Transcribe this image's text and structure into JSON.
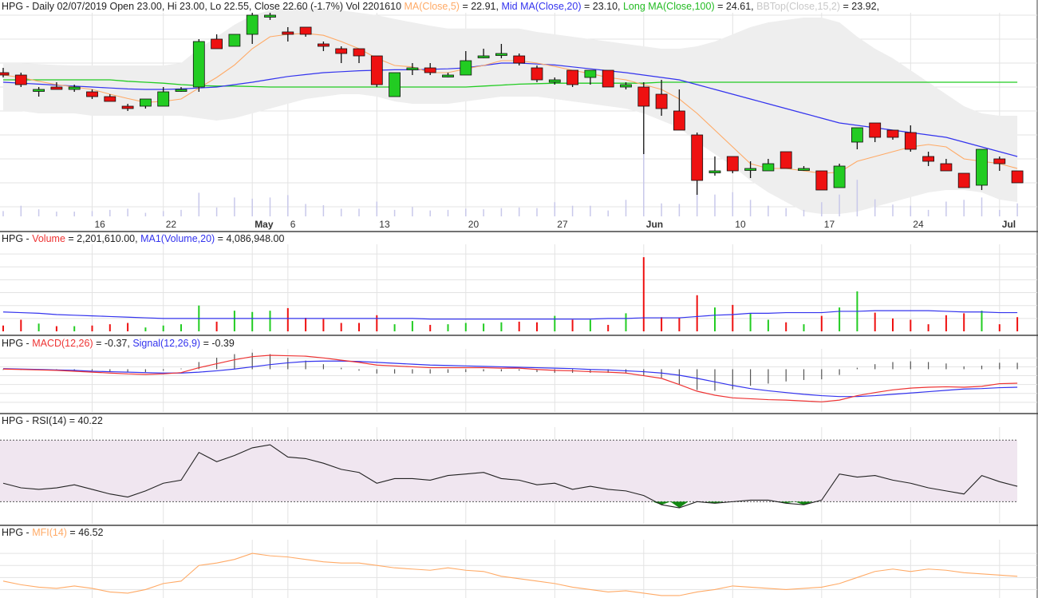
{
  "colors": {
    "up": "#22cc22",
    "down": "#ee1111",
    "ma5": "#ffaa66",
    "mid_ma": "#3333ee",
    "long_ma": "#22cc22",
    "bbtop": "#bbbbbb",
    "band": "#eeeeee",
    "volume": "#ee3333",
    "vol_ma": "#3333ee",
    "macd": "#ee3333",
    "signal": "#3333ee",
    "rsi": "#222222",
    "rsi_fill": "#f0e6f0",
    "rsi_low": "#118811",
    "mfi": "#ffaa66",
    "grid": "#e3e3e3",
    "border": "#444444"
  },
  "header": {
    "symbol": "HPG",
    "text": "HPG - Daily 02/07/2019 Open 23.00, Hi 23.00, Lo 22.55, Close 22.60 (-1.7%) Vol 2201610",
    "ma5_label": "MA(Close,5)",
    "ma5_value": " = 22.91, ",
    "mid_label": "Mid MA(Close,20)",
    "mid_value": " = 23.10, ",
    "long_label": "Long MA(Close,100)",
    "long_value": " = 24.61, ",
    "bb_label": "BBTop(Close,15,2)",
    "bb_value": " = 23.92, "
  },
  "volume_header": {
    "prefix": "HPG - ",
    "label": "Volume",
    "value": " = 2,201,610.00, ",
    "ma_label": "MA1(Volume,20)",
    "ma_value": " = 4,086,948.00"
  },
  "macd_header": {
    "prefix": "HPG - ",
    "label": "MACD(12,26)",
    "value": " = -0.37, ",
    "sig_label": "Signal(12,26,9)",
    "sig_value": " = -0.39"
  },
  "rsi_header": {
    "text": "HPG - RSI(14) = 40.22"
  },
  "mfi_header": {
    "prefix": "HPG - ",
    "label": "MFI(14)",
    "value": " = 46.52"
  },
  "chart_data": {
    "type": "candlestick",
    "price_range": [
      20.8,
      25.05
    ],
    "x_ticks": [
      {
        "i": 5,
        "label": "16"
      },
      {
        "i": 9,
        "label": "22"
      },
      {
        "i": 14,
        "label": "May",
        "bold": true
      },
      {
        "i": 16,
        "label": "6"
      },
      {
        "i": 21,
        "label": "13"
      },
      {
        "i": 26,
        "label": "20"
      },
      {
        "i": 31,
        "label": "27"
      },
      {
        "i": 36,
        "label": "Jun",
        "bold": true
      },
      {
        "i": 41,
        "label": "10"
      },
      {
        "i": 46,
        "label": "17"
      },
      {
        "i": 51,
        "label": "24"
      },
      {
        "i": 56,
        "label": "Jul",
        "bold": true
      }
    ],
    "candles": [
      {
        "o": 23.8,
        "h": 23.9,
        "l": 23.7,
        "c": 23.75
      },
      {
        "o": 23.75,
        "h": 23.8,
        "l": 23.5,
        "c": 23.55
      },
      {
        "o": 23.45,
        "h": 23.5,
        "l": 23.3,
        "c": 23.45
      },
      {
        "o": 23.5,
        "h": 23.6,
        "l": 23.45,
        "c": 23.45
      },
      {
        "o": 23.45,
        "h": 23.55,
        "l": 23.4,
        "c": 23.5
      },
      {
        "o": 23.4,
        "h": 23.45,
        "l": 23.25,
        "c": 23.3
      },
      {
        "o": 23.3,
        "h": 23.35,
        "l": 23.2,
        "c": 23.2
      },
      {
        "o": 23.1,
        "h": 23.15,
        "l": 23.0,
        "c": 23.05
      },
      {
        "o": 23.1,
        "h": 23.25,
        "l": 23.05,
        "c": 23.25
      },
      {
        "o": 23.1,
        "h": 23.5,
        "l": 23.1,
        "c": 23.4
      },
      {
        "o": 23.45,
        "h": 23.5,
        "l": 23.4,
        "c": 23.45
      },
      {
        "o": 23.5,
        "h": 24.5,
        "l": 23.4,
        "c": 24.45
      },
      {
        "o": 24.5,
        "h": 24.6,
        "l": 24.3,
        "c": 24.3
      },
      {
        "o": 24.35,
        "h": 24.6,
        "l": 24.35,
        "c": 24.6
      },
      {
        "o": 24.6,
        "h": 25.05,
        "l": 24.4,
        "c": 25.0
      },
      {
        "o": 25.0,
        "h": 25.05,
        "l": 24.9,
        "c": 25.0
      },
      {
        "o": 24.65,
        "h": 24.75,
        "l": 24.45,
        "c": 24.6
      },
      {
        "o": 24.75,
        "h": 24.75,
        "l": 24.55,
        "c": 24.6
      },
      {
        "o": 24.4,
        "h": 24.45,
        "l": 24.25,
        "c": 24.35
      },
      {
        "o": 24.3,
        "h": 24.35,
        "l": 24.0,
        "c": 24.2
      },
      {
        "o": 24.3,
        "h": 24.3,
        "l": 24.0,
        "c": 24.15
      },
      {
        "o": 24.15,
        "h": 24.15,
        "l": 23.5,
        "c": 23.55
      },
      {
        "o": 23.3,
        "h": 23.8,
        "l": 23.3,
        "c": 23.8
      },
      {
        "o": 23.9,
        "h": 24.0,
        "l": 23.75,
        "c": 23.9
      },
      {
        "o": 23.9,
        "h": 24.0,
        "l": 23.75,
        "c": 23.8
      },
      {
        "o": 23.75,
        "h": 23.8,
        "l": 23.7,
        "c": 23.75
      },
      {
        "o": 23.75,
        "h": 24.25,
        "l": 23.75,
        "c": 24.05
      },
      {
        "o": 24.15,
        "h": 24.3,
        "l": 24.1,
        "c": 24.15
      },
      {
        "o": 24.2,
        "h": 24.4,
        "l": 24.1,
        "c": 24.2
      },
      {
        "o": 24.15,
        "h": 24.2,
        "l": 23.95,
        "c": 24.0
      },
      {
        "o": 23.9,
        "h": 23.95,
        "l": 23.6,
        "c": 23.65
      },
      {
        "o": 23.6,
        "h": 23.7,
        "l": 23.55,
        "c": 23.65
      },
      {
        "o": 23.85,
        "h": 23.85,
        "l": 23.5,
        "c": 23.55
      },
      {
        "o": 23.7,
        "h": 23.85,
        "l": 23.55,
        "c": 23.85
      },
      {
        "o": 23.85,
        "h": 23.85,
        "l": 23.5,
        "c": 23.5
      },
      {
        "o": 23.5,
        "h": 23.6,
        "l": 23.45,
        "c": 23.55
      },
      {
        "o": 23.5,
        "h": 23.6,
        "l": 22.1,
        "c": 23.1
      },
      {
        "o": 23.35,
        "h": 23.65,
        "l": 22.9,
        "c": 23.05
      },
      {
        "o": 23.0,
        "h": 23.45,
        "l": 22.6,
        "c": 22.6
      },
      {
        "o": 22.5,
        "h": 22.55,
        "l": 21.25,
        "c": 21.55
      },
      {
        "o": 21.75,
        "h": 22.05,
        "l": 21.65,
        "c": 21.75
      },
      {
        "o": 22.05,
        "h": 22.05,
        "l": 21.7,
        "c": 21.75
      },
      {
        "o": 21.8,
        "h": 21.95,
        "l": 21.6,
        "c": 21.8
      },
      {
        "o": 21.75,
        "h": 22.0,
        "l": 21.75,
        "c": 21.9
      },
      {
        "o": 22.15,
        "h": 22.15,
        "l": 21.8,
        "c": 21.8
      },
      {
        "o": 21.8,
        "h": 21.85,
        "l": 21.75,
        "c": 21.8
      },
      {
        "o": 21.75,
        "h": 21.75,
        "l": 21.35,
        "c": 21.35
      },
      {
        "o": 21.4,
        "h": 21.9,
        "l": 21.4,
        "c": 21.85
      },
      {
        "o": 22.35,
        "h": 22.65,
        "l": 22.2,
        "c": 22.65
      },
      {
        "o": 22.75,
        "h": 22.75,
        "l": 22.35,
        "c": 22.45
      },
      {
        "o": 22.6,
        "h": 22.6,
        "l": 22.4,
        "c": 22.45
      },
      {
        "o": 22.55,
        "h": 22.7,
        "l": 22.15,
        "c": 22.2
      },
      {
        "o": 22.05,
        "h": 22.15,
        "l": 21.85,
        "c": 21.95
      },
      {
        "o": 21.9,
        "h": 22.0,
        "l": 21.75,
        "c": 21.75
      },
      {
        "o": 21.7,
        "h": 21.7,
        "l": 21.4,
        "c": 21.4
      },
      {
        "o": 21.45,
        "h": 22.2,
        "l": 21.35,
        "c": 22.2
      },
      {
        "o": 22.0,
        "h": 22.05,
        "l": 21.75,
        "c": 21.9
      },
      {
        "o": 21.75,
        "h": 21.75,
        "l": 21.5,
        "c": 21.5
      }
    ],
    "ma5": [
      23.75,
      23.7,
      23.62,
      23.55,
      23.5,
      23.45,
      23.35,
      23.26,
      23.18,
      23.2,
      23.25,
      23.48,
      23.7,
      23.96,
      24.3,
      24.55,
      24.6,
      24.62,
      24.58,
      24.45,
      24.3,
      24.1,
      23.95,
      23.92,
      23.8,
      23.8,
      23.88,
      23.95,
      24.05,
      24.05,
      24.0,
      23.93,
      23.85,
      23.78,
      23.7,
      23.65,
      23.55,
      23.45,
      23.25,
      22.95,
      22.6,
      22.25,
      21.9,
      21.8,
      21.8,
      21.75,
      21.7,
      21.72,
      21.95,
      22.05,
      22.15,
      22.25,
      22.3,
      22.25,
      22.0,
      21.95,
      21.9,
      21.8
    ],
    "mid_ma": [
      23.6,
      23.58,
      23.56,
      23.54,
      23.52,
      23.5,
      23.48,
      23.46,
      23.45,
      23.45,
      23.46,
      23.48,
      23.5,
      23.55,
      23.6,
      23.66,
      23.72,
      23.76,
      23.8,
      23.82,
      23.84,
      23.85,
      23.86,
      23.86,
      23.87,
      23.88,
      23.9,
      23.95,
      24.0,
      24.0,
      23.98,
      23.96,
      23.92,
      23.88,
      23.84,
      23.8,
      23.75,
      23.7,
      23.65,
      23.55,
      23.45,
      23.35,
      23.25,
      23.15,
      23.05,
      22.95,
      22.85,
      22.75,
      22.7,
      22.65,
      22.6,
      22.55,
      22.5,
      22.45,
      22.35,
      22.25,
      22.15,
      22.05
    ],
    "long_ma": [
      23.65,
      23.65,
      23.65,
      23.65,
      23.65,
      23.65,
      23.65,
      23.62,
      23.6,
      23.58,
      23.55,
      23.53,
      23.52,
      23.52,
      23.51,
      23.5,
      23.5,
      23.5,
      23.5,
      23.5,
      23.5,
      23.5,
      23.5,
      23.5,
      23.5,
      23.5,
      23.5,
      23.52,
      23.54,
      23.56,
      23.57,
      23.58,
      23.58,
      23.58,
      23.58,
      23.58,
      23.58,
      23.6,
      23.6,
      23.6,
      23.6,
      23.6,
      23.6,
      23.6,
      23.6,
      23.6,
      23.6,
      23.6,
      23.6,
      23.6,
      23.6,
      23.6,
      23.6,
      23.6,
      23.6,
      23.6,
      23.6,
      23.6
    ],
    "bb_upper": [
      24.0,
      24.0,
      23.98,
      23.96,
      23.95,
      23.95,
      23.95,
      23.95,
      23.95,
      23.95,
      24.0,
      24.3,
      24.55,
      24.8,
      25.0,
      25.1,
      25.15,
      25.15,
      25.12,
      25.1,
      25.05,
      25.0,
      24.92,
      24.85,
      24.78,
      24.72,
      24.72,
      24.72,
      24.72,
      24.72,
      24.65,
      24.6,
      24.55,
      24.5,
      24.45,
      24.4,
      24.35,
      24.3,
      24.3,
      24.35,
      24.45,
      24.6,
      24.75,
      24.85,
      24.9,
      24.95,
      24.95,
      24.85,
      24.55,
      24.3,
      24.1,
      23.85,
      23.6,
      23.35,
      23.1,
      22.95,
      22.9,
      22.9
    ],
    "bb_lower": [
      23.0,
      23.0,
      22.95,
      22.95,
      22.95,
      22.9,
      22.9,
      22.9,
      22.9,
      22.9,
      22.9,
      22.85,
      22.8,
      22.85,
      22.95,
      23.05,
      23.15,
      23.25,
      23.3,
      23.35,
      23.35,
      23.3,
      23.2,
      23.15,
      23.15,
      23.15,
      23.2,
      23.25,
      23.3,
      23.3,
      23.3,
      23.25,
      23.2,
      23.15,
      23.1,
      23.05,
      22.95,
      22.8,
      22.65,
      22.35,
      22.1,
      21.85,
      21.55,
      21.3,
      21.1,
      20.9,
      20.85,
      20.85,
      20.9,
      21.0,
      21.1,
      21.2,
      21.3,
      21.35,
      21.35,
      21.3,
      21.15,
      21.1
    ],
    "volume": {
      "range": [
        0,
        13
      ],
      "values": [
        0.9,
        1.8,
        1.2,
        0.8,
        0.8,
        0.9,
        1.1,
        1.3,
        0.6,
        0.9,
        1.1,
        4.0,
        1.5,
        3.2,
        3.0,
        3.2,
        3.6,
        2.1,
        1.9,
        1.3,
        1.3,
        2.5,
        1.1,
        1.6,
        1.0,
        1.1,
        1.3,
        1.2,
        1.4,
        1.5,
        1.4,
        2.4,
        1.8,
        1.8,
        1.0,
        2.8,
        11.5,
        2.2,
        2.1,
        5.6,
        3.7,
        4.1,
        2.8,
        1.8,
        1.4,
        1.1,
        2.4,
        3.7,
        6.2,
        2.9,
        2.0,
        1.8,
        1.1,
        2.5,
        2.8,
        3.2,
        1.1,
        2.2
      ],
      "ma": [
        3.0,
        2.9,
        2.8,
        2.6,
        2.5,
        2.4,
        2.3,
        2.2,
        2.1,
        2.0,
        2.0,
        2.0,
        2.0,
        2.0,
        2.0,
        2.0,
        2.0,
        2.0,
        2.0,
        2.0,
        2.0,
        2.0,
        2.0,
        2.0,
        1.9,
        1.9,
        1.9,
        1.9,
        1.9,
        1.9,
        1.9,
        1.9,
        1.9,
        1.9,
        2.0,
        2.0,
        2.1,
        2.1,
        2.1,
        2.3,
        2.5,
        2.6,
        2.8,
        2.8,
        2.9,
        2.9,
        2.9,
        3.1,
        3.1,
        3.2,
        3.2,
        3.2,
        3.2,
        3.1,
        3.0,
        3.0,
        2.9,
        2.9
      ]
    },
    "macd": {
      "range": [
        -1.0,
        0.35
      ],
      "macd": [
        -0.05,
        -0.06,
        -0.07,
        -0.08,
        -0.1,
        -0.12,
        -0.14,
        -0.16,
        -0.17,
        -0.16,
        -0.13,
        -0.02,
        0.07,
        0.16,
        0.23,
        0.26,
        0.25,
        0.24,
        0.2,
        0.15,
        0.1,
        0.04,
        0.02,
        0.0,
        -0.02,
        -0.02,
        -0.02,
        -0.02,
        -0.03,
        -0.03,
        -0.06,
        -0.08,
        -0.09,
        -0.11,
        -0.12,
        -0.14,
        -0.2,
        -0.26,
        -0.4,
        -0.55,
        -0.64,
        -0.7,
        -0.72,
        -0.74,
        -0.75,
        -0.77,
        -0.79,
        -0.75,
        -0.65,
        -0.58,
        -0.52,
        -0.48,
        -0.46,
        -0.45,
        -0.46,
        -0.44,
        -0.38,
        -0.37
      ],
      "signal": [
        -0.04,
        -0.05,
        -0.06,
        -0.07,
        -0.08,
        -0.1,
        -0.11,
        -0.12,
        -0.13,
        -0.14,
        -0.14,
        -0.12,
        -0.09,
        -0.05,
        0.0,
        0.05,
        0.09,
        0.12,
        0.13,
        0.13,
        0.12,
        0.1,
        0.08,
        0.06,
        0.04,
        0.03,
        0.02,
        0.01,
        0.0,
        -0.01,
        -0.02,
        -0.03,
        -0.04,
        -0.06,
        -0.07,
        -0.09,
        -0.11,
        -0.14,
        -0.19,
        -0.26,
        -0.34,
        -0.42,
        -0.49,
        -0.54,
        -0.58,
        -0.62,
        -0.65,
        -0.67,
        -0.67,
        -0.65,
        -0.62,
        -0.59,
        -0.56,
        -0.53,
        -0.5,
        -0.49,
        -0.47,
        -0.46
      ]
    },
    "rsi": {
      "range": [
        25,
        80
      ],
      "bands": [
        30,
        70
      ],
      "values": [
        42,
        39,
        38,
        39,
        41,
        38,
        35,
        33,
        37,
        42,
        44,
        62,
        56,
        60,
        65,
        67,
        59,
        58,
        55,
        51,
        49,
        42,
        45,
        45,
        44,
        47,
        48,
        49,
        45,
        44,
        41,
        42,
        38,
        40,
        38,
        37,
        34,
        28,
        26,
        30,
        29,
        30,
        31,
        31,
        29,
        28,
        31,
        48,
        46,
        47,
        44,
        42,
        39,
        37,
        35,
        47,
        43,
        40
      ]
    },
    "mfi": {
      "range": [
        28,
        75
      ],
      "values": [
        42,
        39,
        37,
        36,
        38,
        36,
        33,
        32,
        35,
        40,
        42,
        55,
        57,
        60,
        65,
        63,
        62,
        60,
        58,
        57,
        57,
        55,
        53,
        52,
        51,
        53,
        51,
        50,
        46,
        44,
        42,
        40,
        37,
        35,
        33,
        34,
        32,
        30,
        30,
        33,
        35,
        38,
        37,
        36,
        35,
        36,
        37,
        40,
        45,
        50,
        52,
        50,
        52,
        51,
        49,
        48,
        47,
        46
      ]
    }
  }
}
